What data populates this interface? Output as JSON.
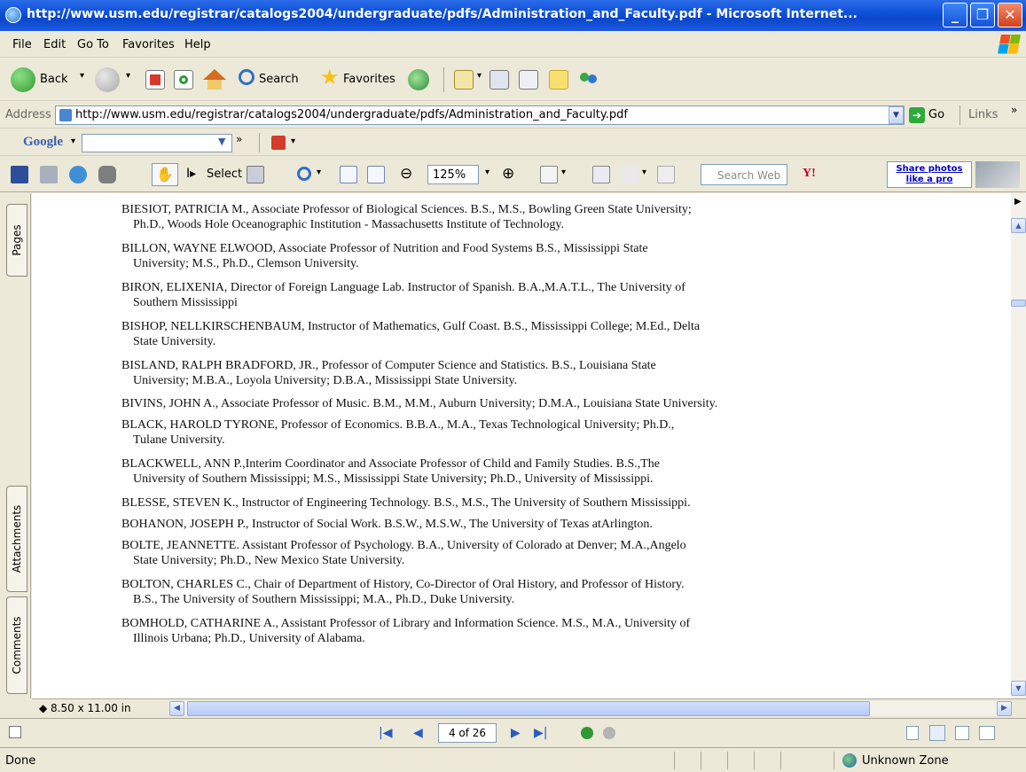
{
  "window": {
    "title": "http://www.usm.edu/registrar/catalogs2004/undergraduate/pdfs/Administration_and_Faculty.pdf - Microsoft Internet...",
    "minimize": "_",
    "maximize": "❐",
    "close": "✕"
  },
  "menu": {
    "items": [
      "File",
      "Edit",
      "Go To",
      "Favorites",
      "Help"
    ]
  },
  "toolbar": {
    "back": "Back",
    "search": "Search",
    "favorites": "Favorites"
  },
  "address": {
    "label": "Address",
    "url": "http://www.usm.edu/registrar/catalogs2004/undergraduate/pdfs/Administration_and_Faculty.pdf",
    "go": "Go",
    "links": "Links"
  },
  "google": {
    "logo": "Google",
    "query": ""
  },
  "pdf_toolbar": {
    "select": "Select",
    "zoom": "125%",
    "search_placeholder": "Search Web",
    "share": "Share photos like a pro"
  },
  "nav_tabs": {
    "pages": "Pages",
    "attachments": "Attachments",
    "comments": "Comments"
  },
  "document": {
    "entries": [
      {
        "first": "BIESIOT, PATRICIA M., Associate Professor of Biological Sciences. B.S., M.S., Bowling Green State University;",
        "cont": "Ph.D., Woods Hole Oceanographic Institution - Massachusetts Institute of Technology."
      },
      {
        "first": "BILLON, WAYNE ELWOOD, Associate Professor of Nutrition and Food Systems B.S., Mississippi State",
        "cont": "University; M.S., Ph.D., Clemson University."
      },
      {
        "first": "BIRON, ELIXENIA,  Director of Foreign Language Lab. Instructor of Spanish. B.A.,M.A.T.L., The University of",
        "cont": "Southern Mississippi"
      },
      {
        "first": "BISHOP, NELLKIRSCHENBAUM, Instructor of Mathematics, Gulf Coast. B.S., Mississippi College; M.Ed., Delta",
        "cont": "State University."
      },
      {
        "first": "BISLAND, RALPH BRADFORD, JR., Professor of Computer Science and Statistics. B.S., Louisiana State",
        "cont": "University; M.B.A., Loyola University; D.B.A., Mississippi State University."
      },
      {
        "first": "BIVINS, JOHN A., Associate Professor of Music. B.M., M.M., Auburn University; D.M.A., Louisiana State University.",
        "cont": ""
      },
      {
        "first": "BLACK, HAROLD TYRONE, Professor of Economics. B.B.A., M.A., Texas Technological University; Ph.D.,",
        "cont": "Tulane University."
      },
      {
        "first": "BLACKWELL, ANN P.,Interim Coordinator and Associate Professor of Child and Family Studies. B.S.,The",
        "cont": "University of Southern Mississippi; M.S., Mississippi State University; Ph.D., University of Mississippi."
      },
      {
        "first": "BLESSE, STEVEN K., Instructor of Engineering Technology. B.S., M.S., The University of Southern Mississippi.",
        "cont": ""
      },
      {
        "first": "BOHANON, JOSEPH P., Instructor of Social Work. B.S.W., M.S.W., The University of Texas atArlington.",
        "cont": ""
      },
      {
        "first": "BOLTE, JEANNETTE. Assistant Professor of Psychology. B.A., University of Colorado at Denver; M.A.,Angelo",
        "cont": "State University; Ph.D., New Mexico State University."
      },
      {
        "first": "BOLTON, CHARLES C., Chair of Department of History, Co-Director of Oral History, and Professor of History.",
        "cont": "B.S., The University of Southern Mississippi; M.A., Ph.D., Duke University."
      },
      {
        "first": "BOMHOLD, CATHARINE A., Assistant Professor of Library and Information Science. M.S., M.A., University of",
        "cont": "Illinois Urbana; Ph.D., University of Alabama."
      }
    ]
  },
  "page_size": "8.50 x 11.00 in",
  "page_nav": {
    "current": "4 of 26"
  },
  "status": {
    "left": "Done",
    "zone": "Unknown Zone"
  }
}
